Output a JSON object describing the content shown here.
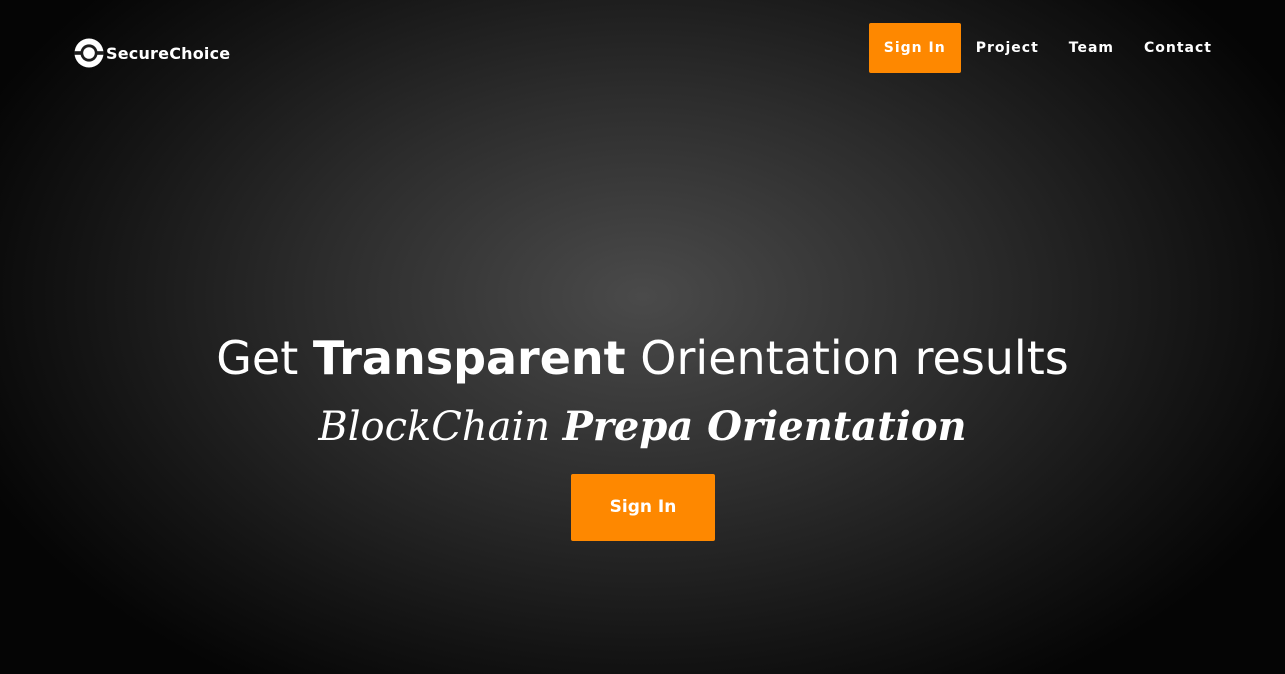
{
  "brand": {
    "name": "SecureChoice",
    "icon": "ring-logo-icon"
  },
  "nav": {
    "items": [
      {
        "label": "Sign In",
        "active": true
      },
      {
        "label": "Project",
        "active": false
      },
      {
        "label": "Team",
        "active": false
      },
      {
        "label": "Contact",
        "active": false
      }
    ]
  },
  "hero": {
    "heading_prefix": "Get",
    "heading_strong": "Transparent",
    "heading_suffix": "Orientation results",
    "subheading_prefix": "BlockChain",
    "subheading_strong": "Prepa Orientation",
    "cta_label": "Sign In"
  },
  "colors": {
    "accent": "#fe8800",
    "text": "#ffffff",
    "background_center": "#4a4a4a",
    "background_edge": "#000000"
  }
}
